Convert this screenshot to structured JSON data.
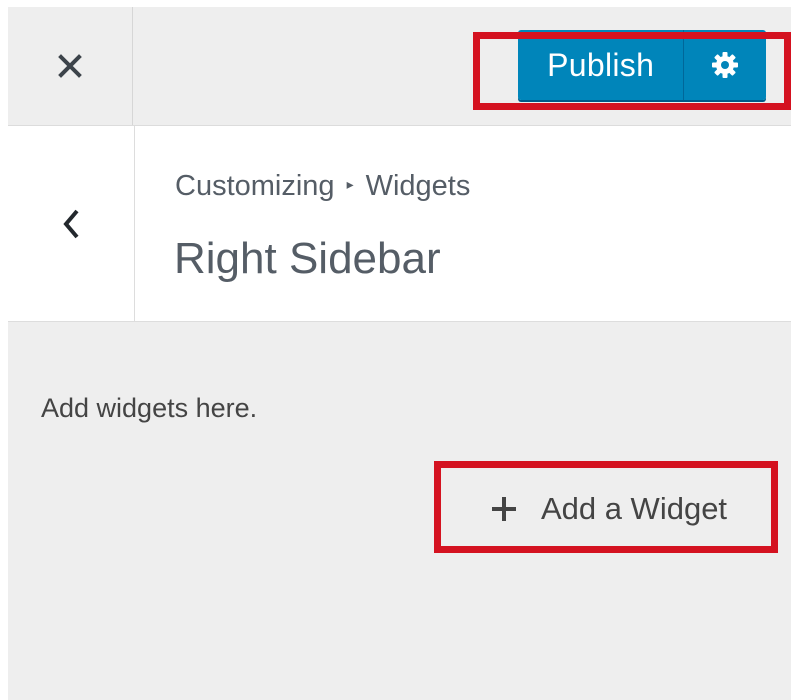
{
  "header": {
    "close_icon": "close-icon",
    "publish_label": "Publish",
    "settings_icon": "gear-icon",
    "accent_color": "#0085ba"
  },
  "section": {
    "back_icon": "chevron-left-icon",
    "breadcrumb": {
      "parent": "Customizing",
      "separator_icon": "triangle-right-icon",
      "current": "Widgets"
    },
    "title": "Right Sidebar"
  },
  "body": {
    "description": "Add widgets here.",
    "add_widget_label": "Add a Widget",
    "add_widget_icon": "plus-icon"
  },
  "annotations": {
    "highlight_color": "#d41220"
  }
}
